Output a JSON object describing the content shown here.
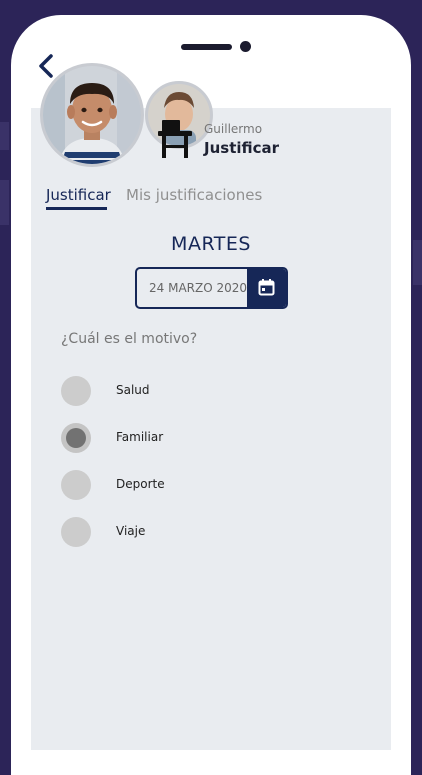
{
  "profile": {
    "student_name": "Guillermo",
    "action_title": "Justificar"
  },
  "tabs": [
    {
      "label": "Justificar",
      "active": true
    },
    {
      "label": "Mis justificaciones",
      "active": false
    }
  ],
  "day": "MARTES",
  "date": "24 MARZO 2020",
  "question": "¿Cuál es el motivo?",
  "options": [
    {
      "label": "Salud",
      "selected": false
    },
    {
      "label": "Familiar",
      "selected": true
    },
    {
      "label": "Deporte",
      "selected": false
    },
    {
      "label": "Viaje",
      "selected": false
    }
  ],
  "colors": {
    "navy": "#162757",
    "frame": "#2c2458",
    "screen": "#e9ecf0"
  }
}
